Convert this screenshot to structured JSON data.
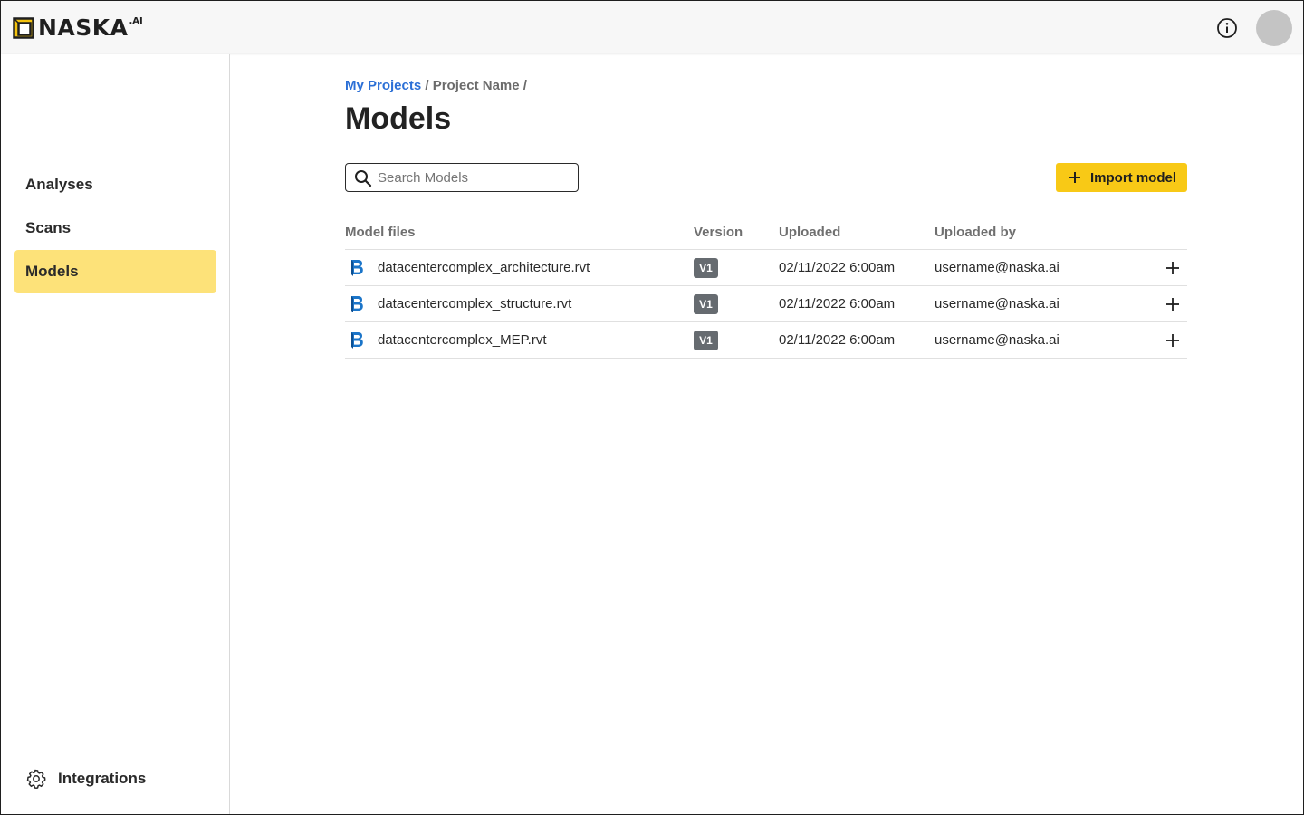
{
  "app": {
    "brand": "NASKA",
    "brand_suffix": ".AI",
    "accent_color": "#f8c916",
    "active_nav_color": "#fde279",
    "link_color": "#2b6fd6"
  },
  "header": {
    "info_icon": "info-circle-icon",
    "avatar": "user-avatar"
  },
  "sidebar": {
    "items": [
      {
        "label": "Analyses",
        "active": false
      },
      {
        "label": "Scans",
        "active": false
      },
      {
        "label": "Models",
        "active": true
      }
    ],
    "footer": {
      "label": "Integrations",
      "icon": "gear-icon"
    }
  },
  "breadcrumb": {
    "root": "My Projects",
    "sep1": " / ",
    "project": "Project Name",
    "sep2": " /"
  },
  "page": {
    "title": "Models"
  },
  "search": {
    "placeholder": "Search Models",
    "value": ""
  },
  "import_button": {
    "label": "Import model",
    "icon": "plus-icon"
  },
  "table": {
    "columns": [
      "Model files",
      "Version",
      "Uploaded",
      "Uploaded by"
    ],
    "rows": [
      {
        "file": "datacentercomplex_architecture.rvt",
        "version": "V1",
        "uploaded": "02/11/2022 6:00am",
        "uploaded_by": "username@naska.ai",
        "file_icon": "bim-file-icon"
      },
      {
        "file": "datacentercomplex_structure.rvt",
        "version": "V1",
        "uploaded": "02/11/2022 6:00am",
        "uploaded_by": "username@naska.ai",
        "file_icon": "bim-file-icon"
      },
      {
        "file": "datacentercomplex_MEP.rvt",
        "version": "V1",
        "uploaded": "02/11/2022 6:00am",
        "uploaded_by": "username@naska.ai",
        "file_icon": "bim-file-icon"
      }
    ]
  }
}
